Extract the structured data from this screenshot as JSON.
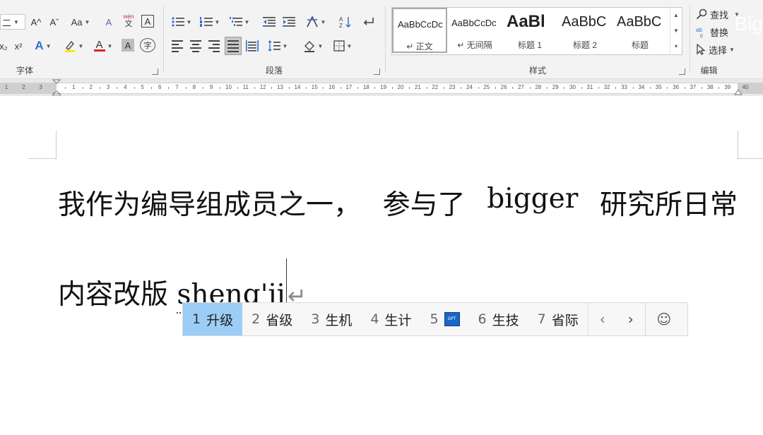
{
  "ribbon": {
    "font_group": {
      "label": "字体",
      "font_size_value": "二",
      "grow_font_icon": "A^",
      "shrink_font_icon": "Aˇ",
      "change_case_label": "Aa",
      "clear_format_icon": "A",
      "phonetic_top": "wén",
      "phonetic_bottom": "文",
      "char_border_label": "A",
      "subscript_label": "x₂",
      "superscript_label": "x²",
      "text_effect_label": "A",
      "highlight_color": "#ffe600",
      "font_color": "#e02020",
      "font_color_label": "A",
      "char_shading_label": "A",
      "enclose_char_label": "字"
    },
    "paragraph_group": {
      "label": "段落"
    },
    "styles_group": {
      "label": "样式",
      "styles": [
        {
          "sample": "AaBbCcDc",
          "name": "↵ 正文"
        },
        {
          "sample": "AaBbCcDc",
          "name": "↵ 无间隔"
        },
        {
          "sample": "AaBl",
          "name": "标题 1"
        },
        {
          "sample": "AaBbC",
          "name": "标题 2"
        },
        {
          "sample": "AaBbC",
          "name": "标题"
        }
      ]
    },
    "editing_group": {
      "label": "编辑",
      "find_label": "查找",
      "replace_label": "替换",
      "select_label": "选择"
    }
  },
  "ruler": {
    "left_numbers": [
      "3",
      "2",
      "1"
    ],
    "numbers": [
      "1",
      "2",
      "3",
      "4",
      "5",
      "6",
      "7",
      "8",
      "9",
      "10",
      "11",
      "12",
      "13",
      "14",
      "15",
      "16",
      "17",
      "18",
      "19",
      "20",
      "21",
      "22",
      "23",
      "24",
      "25",
      "26",
      "27",
      "28",
      "29",
      "30",
      "31",
      "32",
      "33",
      "34",
      "35",
      "36",
      "37",
      "38",
      "39"
    ],
    "right_number": "40"
  },
  "document": {
    "line1_segments": [
      "我作为编导组成员之一，",
      "参与了",
      "bigger",
      "研究所日常"
    ],
    "line2_text": "内容改版 ",
    "pinyin_input": "sheng'ji",
    "paragraph_mark": "↵"
  },
  "ime": {
    "candidates": [
      {
        "num": "1",
        "text": "升级"
      },
      {
        "num": "2",
        "text": "省级"
      },
      {
        "num": "3",
        "text": "生机"
      },
      {
        "num": "4",
        "text": "生计"
      },
      {
        "num": "5",
        "text": ""
      },
      {
        "num": "6",
        "text": "生技"
      },
      {
        "num": "7",
        "text": "省际"
      }
    ],
    "prev_icon": "‹",
    "next_icon": "›",
    "emoji_icon": "☺"
  },
  "watermark": "Big"
}
